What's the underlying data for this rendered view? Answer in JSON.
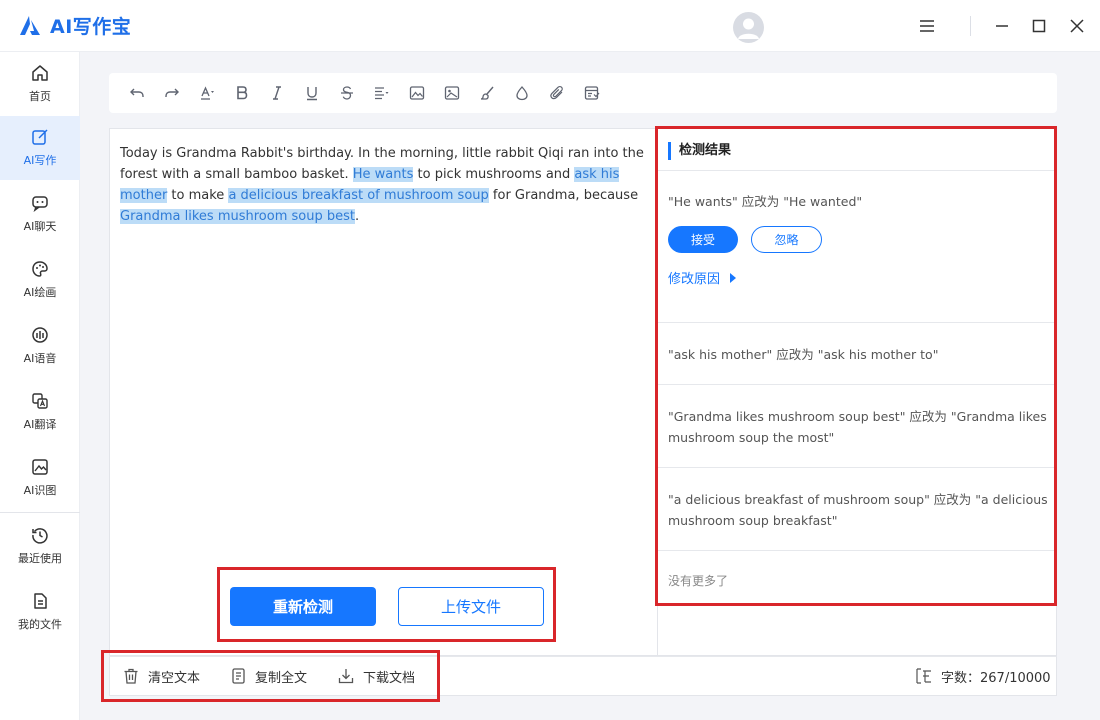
{
  "app": {
    "title": "AI写作宝"
  },
  "sidebar": {
    "items": [
      {
        "label": "首页",
        "icon": "home-icon"
      },
      {
        "label": "AI写作",
        "icon": "write-icon",
        "active": true
      },
      {
        "label": "AI聊天",
        "icon": "chat-icon"
      },
      {
        "label": "AI绘画",
        "icon": "palette-icon"
      },
      {
        "label": "AI语音",
        "icon": "voice-icon"
      },
      {
        "label": "AI翻译",
        "icon": "translate-icon"
      },
      {
        "label": "AI识图",
        "icon": "image-recognize-icon"
      },
      {
        "label": "最近使用",
        "icon": "history-icon"
      },
      {
        "label": "我的文件",
        "icon": "file-icon"
      }
    ]
  },
  "editor": {
    "segments": [
      " Today is Grandma Rabbit's birthday. In the morning, little rabbit Qiqi ran into the forest with a small bamboo basket. ",
      "He wants",
      " to pick mushrooms and ",
      "ask his mother",
      " to make ",
      "a delicious breakfast of mushroom soup",
      " for Grandma, because ",
      "Grandma likes mushroom soup best",
      "."
    ],
    "recheck_label": "重新检测",
    "upload_label": "上传文件"
  },
  "results": {
    "title": "检测结果",
    "suggestions": [
      "\"He wants\" 应改为 \"He wanted\"",
      "\"ask his mother\" 应改为 \"ask his mother to\"",
      "\"Grandma likes mushroom soup best\" 应改为 \"Grandma likes mushroom soup the most\"",
      "\"a delicious breakfast of mushroom soup\" 应改为 \"a delicious mushroom soup breakfast\""
    ],
    "accept_label": "接受",
    "ignore_label": "忽略",
    "reason_label": "修改原因",
    "no_more": "没有更多了"
  },
  "bottom": {
    "clear_label": "清空文本",
    "copy_label": "复制全文",
    "download_label": "下载文档",
    "word_count": "字数：267/10000"
  },
  "colors": {
    "accent": "#1677ff",
    "highlight": "#bcdcf7",
    "annotation": "#d9262a"
  }
}
